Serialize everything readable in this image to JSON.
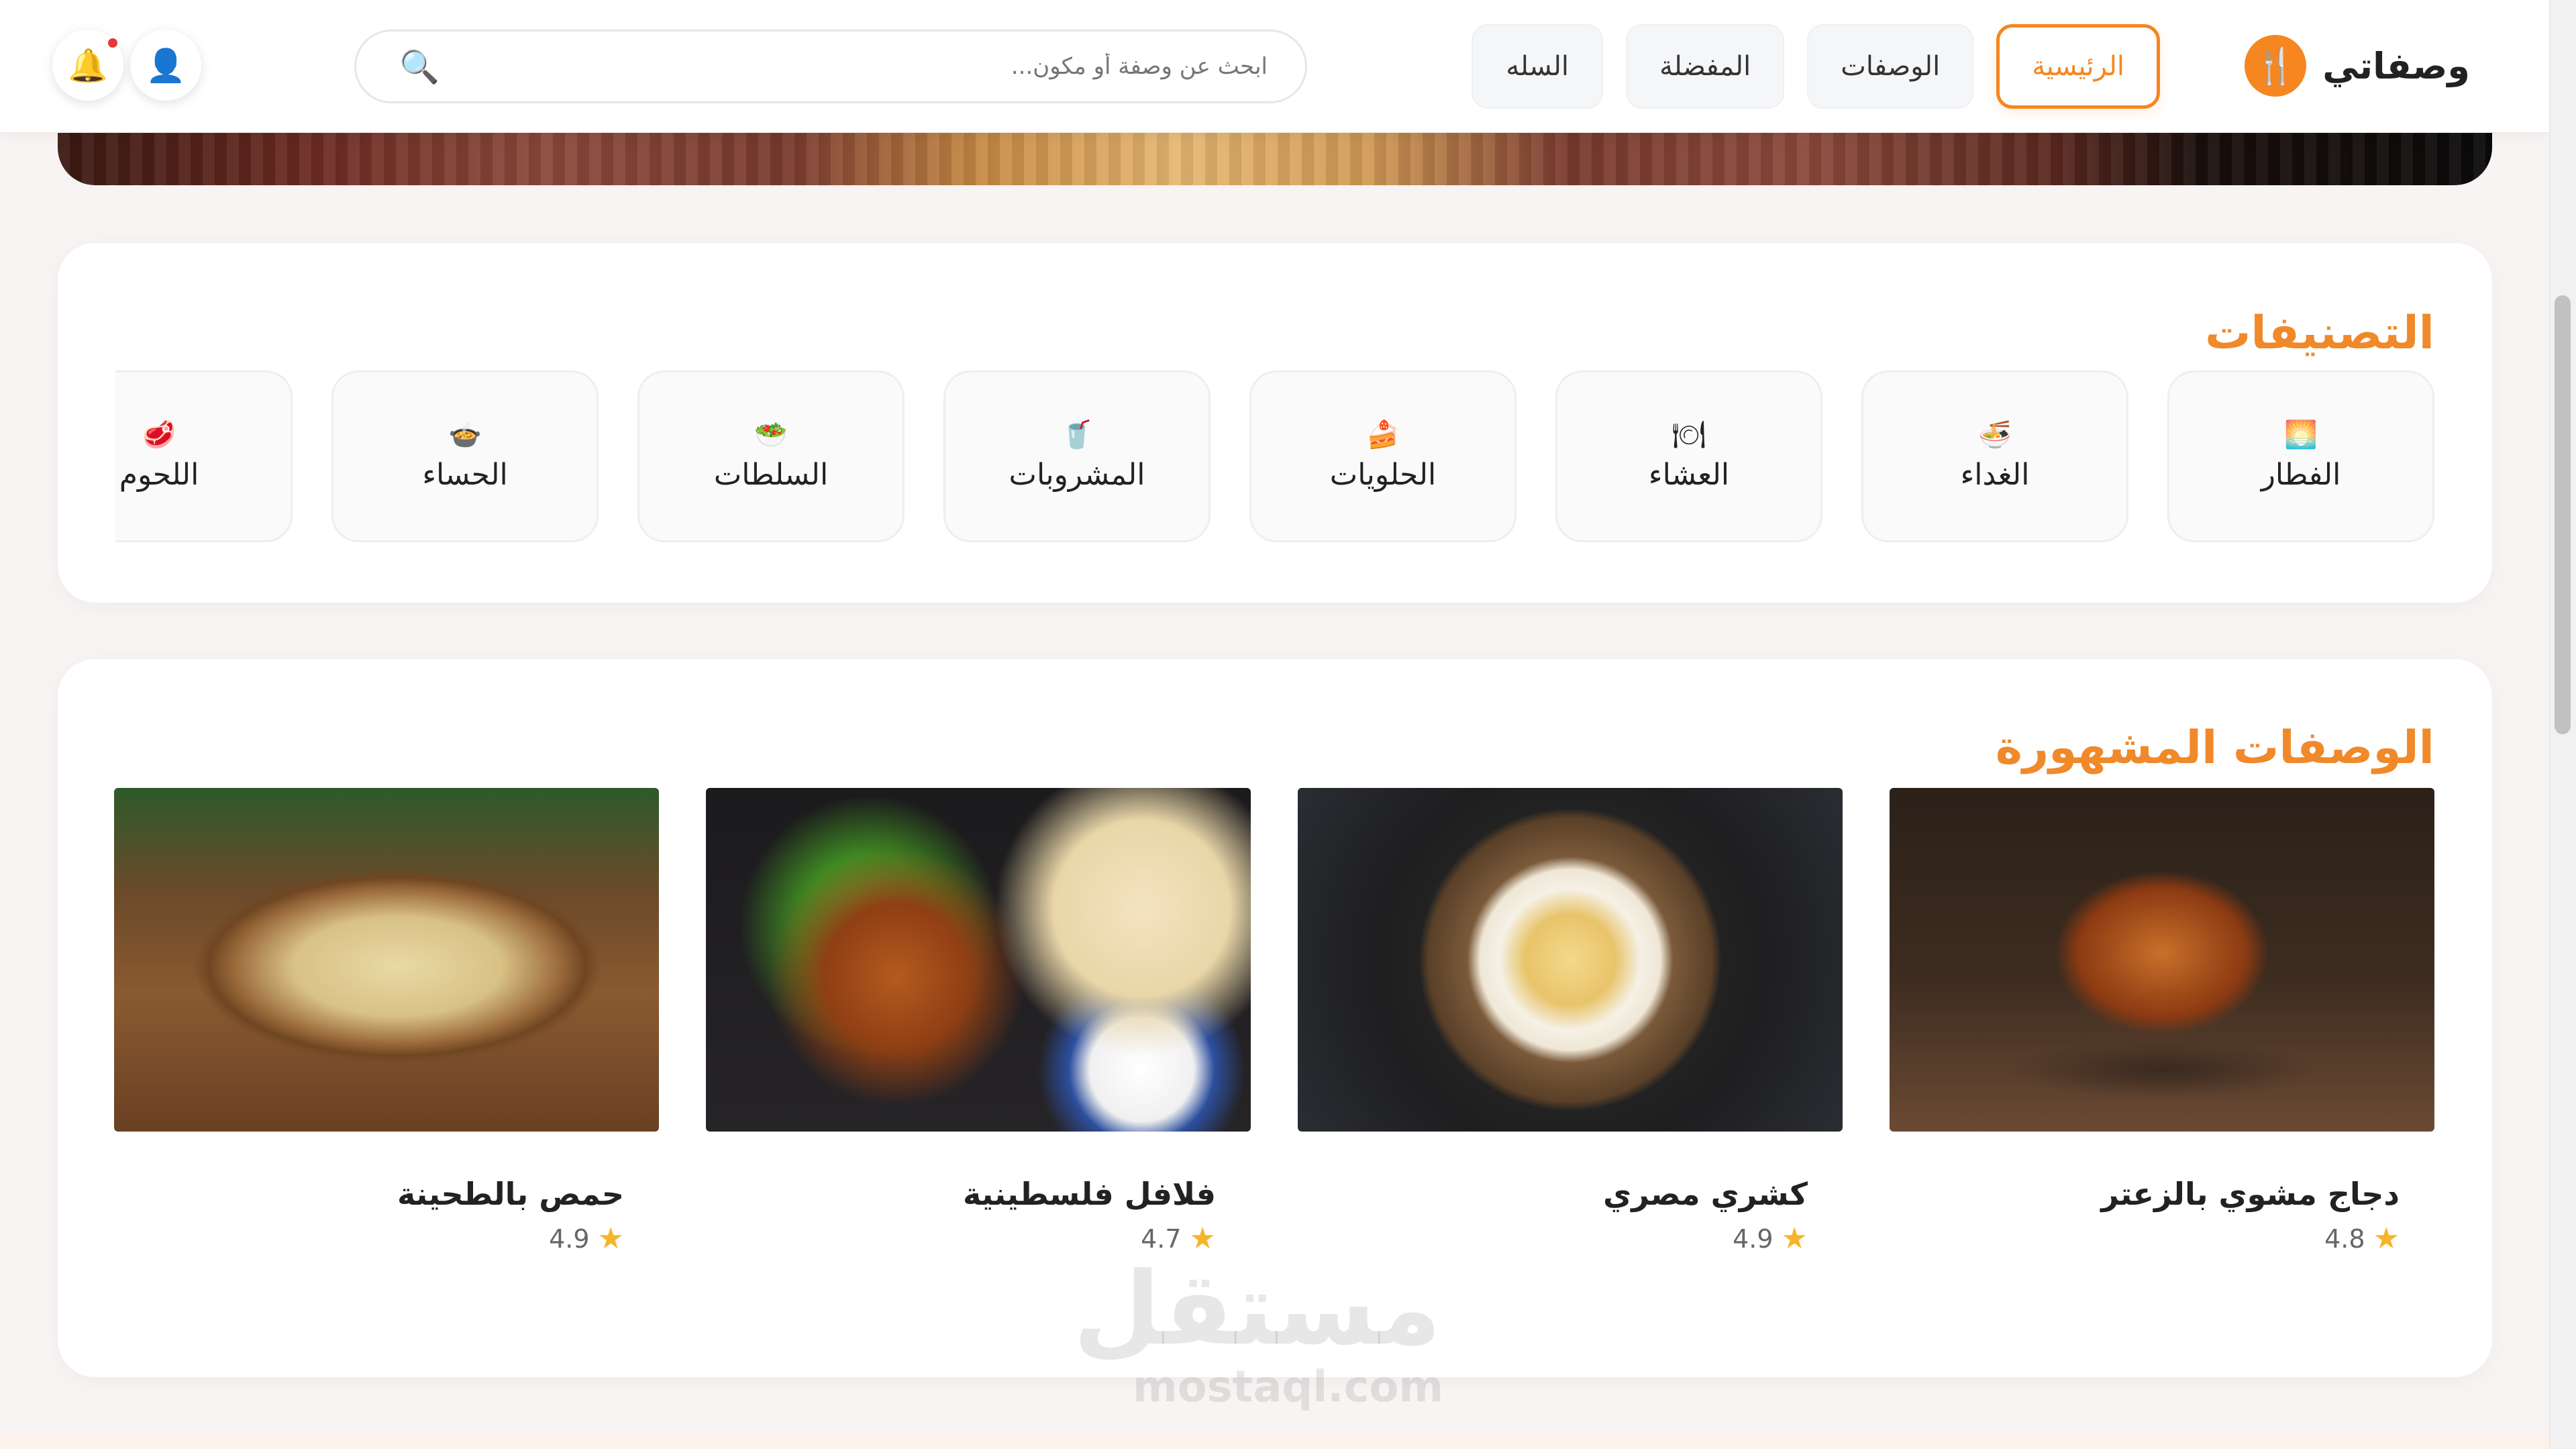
{
  "brand": {
    "name": "وصفاتي",
    "logo_icon": "utensils-icon",
    "accent_color": "#f6861f"
  },
  "nav": [
    {
      "label": "الرئيسية",
      "active": true
    },
    {
      "label": "الوصفات",
      "active": false
    },
    {
      "label": "المفضلة",
      "active": false
    },
    {
      "label": "السله",
      "active": false
    }
  ],
  "search": {
    "placeholder": "ابحث عن وصفة أو مكون..."
  },
  "header_icons": {
    "user": "user-icon",
    "bell": "bell-icon"
  },
  "categories": {
    "title": "التصنيفات",
    "items": [
      {
        "label": "الفطار",
        "icon": "🌅"
      },
      {
        "label": "الغداء",
        "icon": "🍜"
      },
      {
        "label": "العشاء",
        "icon": "🍽"
      },
      {
        "label": "الحلويات",
        "icon": "🍰"
      },
      {
        "label": "المشروبات",
        "icon": "🥤"
      },
      {
        "label": "السلطات",
        "icon": "🥗"
      },
      {
        "label": "الحساء",
        "icon": "🍲"
      },
      {
        "label": "اللحوم",
        "icon": "🥩"
      }
    ]
  },
  "recipes": {
    "title": "الوصفات المشهورة",
    "items": [
      {
        "name": "دجاج مشوي بالزعتر",
        "rating": "4.8"
      },
      {
        "name": "كشري مصري",
        "rating": "4.9"
      },
      {
        "name": "فلافل فلسطينية",
        "rating": "4.7"
      },
      {
        "name": "حمص بالطحينة",
        "rating": "4.9"
      }
    ]
  },
  "watermark": {
    "arabic": "مستقل",
    "latin": "mostaql.com"
  }
}
